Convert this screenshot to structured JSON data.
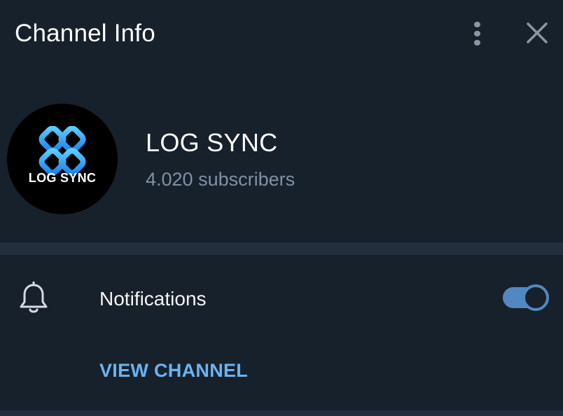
{
  "header": {
    "title": "Channel Info",
    "menu_icon": "more-vertical-icon",
    "close_icon": "close-icon"
  },
  "channel": {
    "avatar_text": "LOG SYNC",
    "name": "LOG SYNC",
    "subscribers": "4.020 subscribers"
  },
  "settings": {
    "notifications_label": "Notifications",
    "notifications_enabled": true,
    "bell_icon": "bell-icon"
  },
  "actions": {
    "view_channel_label": "VIEW CHANNEL"
  },
  "colors": {
    "background": "#17212b",
    "separator": "#232e3c",
    "accent": "#5288c1",
    "link": "#6ab3f3",
    "secondary_text": "#7f91a4",
    "logo_blue": "#2aa8ff"
  }
}
